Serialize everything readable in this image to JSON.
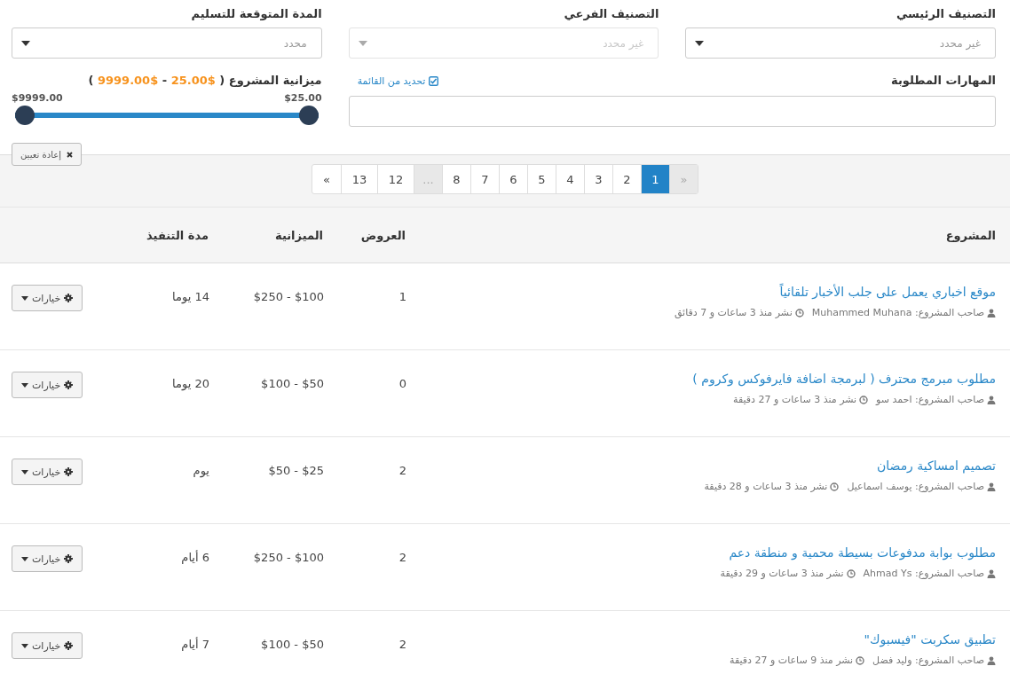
{
  "filters": [
    {
      "label": "التصنيف الرئيسي",
      "value": "غير محدد",
      "disabled": false
    },
    {
      "label": "التصنيف الفرعي",
      "value": "غير محدد",
      "disabled": true
    },
    {
      "label": "المدة المتوقعة للتسليم",
      "value": "محدد",
      "disabled": false
    }
  ],
  "skills": {
    "label": "المهارات المطلوبة",
    "pick_link": "تحديد من القائمة",
    "checked": true
  },
  "budget": {
    "label": "ميزانية المشروع ( **$25.00** - **$9999.00** )",
    "range_labels": [
      "$25.00",
      "$9999.00"
    ],
    "level": 1
  },
  "reset_button": "إعادة تعيين",
  "pagination": [
    {
      "label": "»",
      "selected": false,
      "disabled": true
    },
    {
      "label": "1",
      "selected": true,
      "disabled": false
    },
    {
      "label": "2",
      "selected": false,
      "disabled": false
    },
    {
      "label": "3",
      "selected": false,
      "disabled": false
    },
    {
      "label": "4",
      "selected": false,
      "disabled": false
    },
    {
      "label": "5",
      "selected": false,
      "disabled": false
    },
    {
      "label": "6",
      "selected": false,
      "disabled": false
    },
    {
      "label": "7",
      "selected": false,
      "disabled": false
    },
    {
      "label": "8",
      "selected": false,
      "disabled": false
    },
    {
      "label": "...",
      "selected": false,
      "disabled": true
    },
    {
      "label": "12",
      "selected": false,
      "disabled": false
    },
    {
      "label": "13",
      "selected": false,
      "disabled": false
    },
    {
      "label": "«",
      "selected": false,
      "disabled": false
    }
  ],
  "table": {
    "columns": [
      "المشروع",
      "العروض",
      "الميزانية",
      "مدة التنفيذ"
    ],
    "rows": [
      {
        "title": "موقع اخباري يعمل على جلب الأخبار تلقائياً",
        "owner": "صاحب المشروع: Muhammed Muhana",
        "posted": "نشر منذ 3 ساعات و 7 دقائق",
        "offers": "1",
        "budget": "$100 - $250",
        "duration": "14 يوما",
        "action": "خيارات"
      },
      {
        "title": "مطلوب مبرمج محترف ( لبرمجة اضافة فايرفوكس وكروم )",
        "owner": "صاحب المشروع: احمد سو",
        "posted": "نشر منذ 3 ساعات و 27 دقيقة",
        "offers": "0",
        "budget": "$50 - $100",
        "duration": "20 يوما",
        "action": "خيارات"
      },
      {
        "title": "تصميم امساكية رمضان",
        "owner": "صاحب المشروع: يوسف اسماعيل",
        "posted": "نشر منذ 3 ساعات و 28 دقيقة",
        "offers": "2",
        "budget": "$25 - $50",
        "duration": "يوم",
        "action": "خيارات"
      },
      {
        "title": "مطلوب بوابة مدفوعات بسيطة محمية و منطقة دعم",
        "owner": "صاحب المشروع: Ahmad Ys",
        "posted": "نشر منذ 3 ساعات و 29 دقيقة",
        "offers": "2",
        "budget": "$100 - $250",
        "duration": "6 أيام",
        "action": "خيارات"
      },
      {
        "title": "تطبيق سكربت \"فيسبوك\"",
        "owner": "صاحب المشروع: وليد فضل",
        "posted": "نشر منذ 9 ساعات و 27 دقيقة",
        "offers": "2",
        "budget": "$50 - $100",
        "duration": "7 أيام",
        "action": "خيارات"
      }
    ]
  }
}
